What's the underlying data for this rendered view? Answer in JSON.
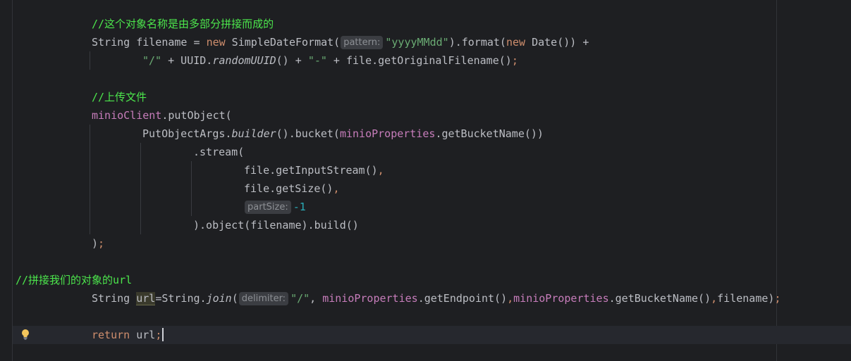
{
  "editor": {
    "comment_object_name": "//这个对象名称是由多部分拼接而成的",
    "comment_upload": "//上传文件",
    "comment_url": "//拼接我们的对象的url",
    "hint_pattern": "pattern:",
    "hint_part_size": "partSize:",
    "hint_delimiter": "delimiter:",
    "kw_new": "new",
    "kw_return": "return",
    "str_date_format": "\"yyyyMMdd\"",
    "str_slash": "\"/\"",
    "str_dash": "\"-\"",
    "num_minus_one": "-1",
    "field_minio_client": "minioClient",
    "field_minio_properties": "minioProperties",
    "var_url": "url"
  },
  "colors": {
    "background": "#1e1f22",
    "comment": "#4ce64c",
    "keyword": "#cf8e6d",
    "string": "#6aab73",
    "number": "#2aacb8",
    "field": "#c77dbb",
    "default_text": "#bcbec4"
  },
  "icons": [
    "lightbulb-icon"
  ]
}
